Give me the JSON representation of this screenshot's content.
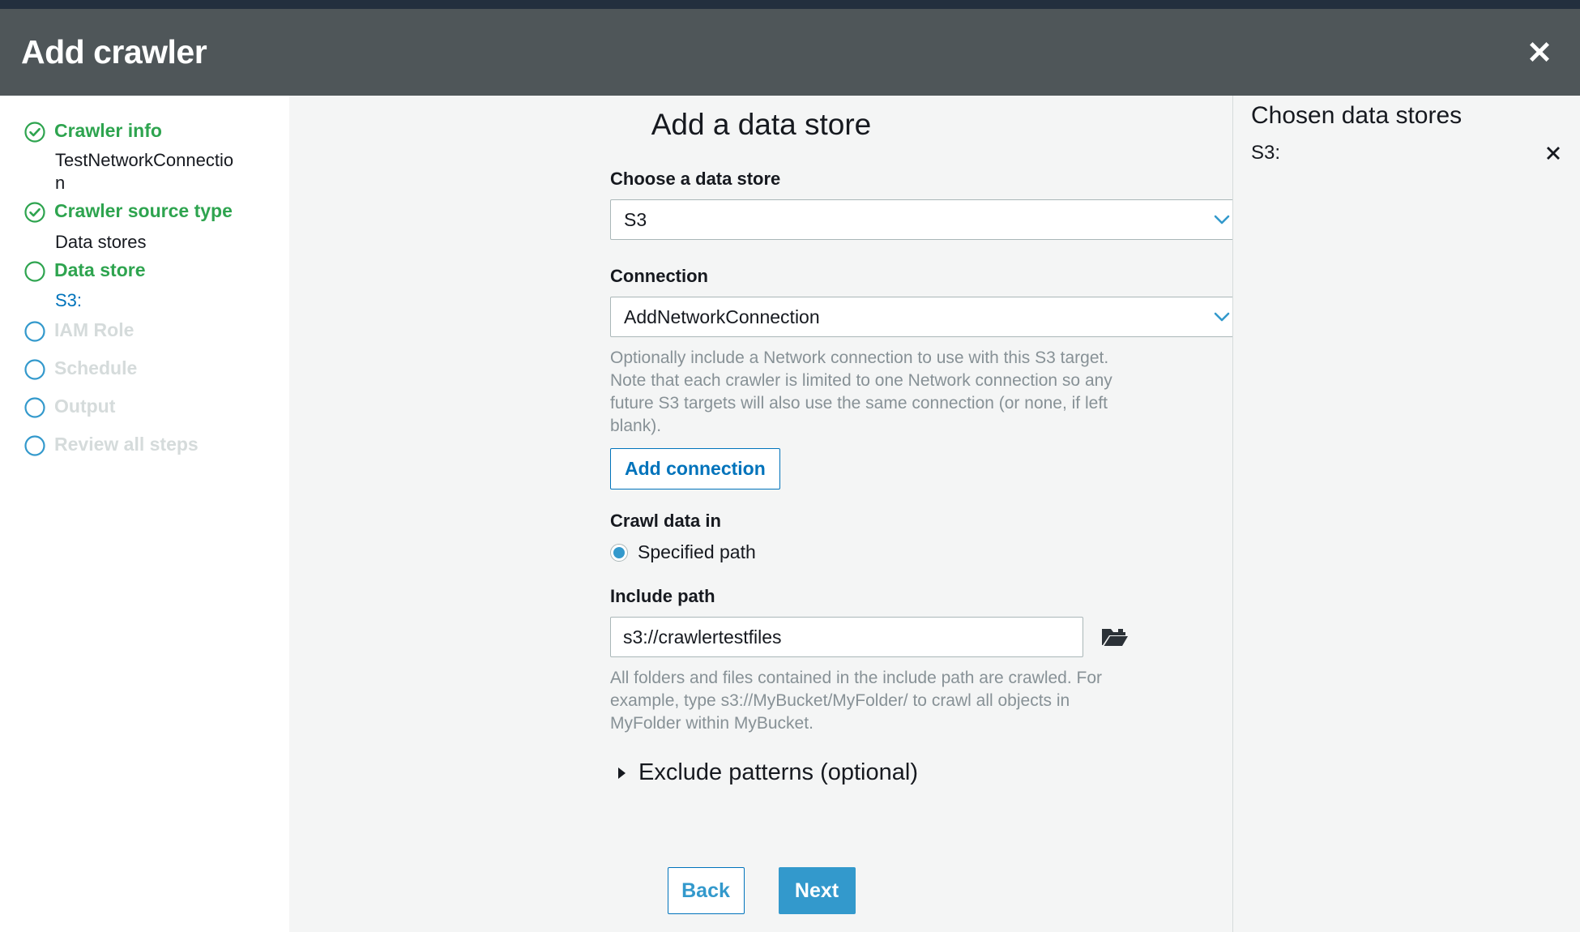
{
  "header": {
    "title": "Add crawler",
    "close_icon": "close-icon"
  },
  "sidebar": {
    "steps": [
      {
        "label": "Crawler info",
        "state": "done",
        "icon": "check-circle-icon"
      },
      {
        "label": "Crawler source type",
        "state": "done",
        "icon": "check-circle-icon"
      },
      {
        "label": "Data store",
        "state": "current",
        "icon": "circle-icon"
      },
      {
        "label": "IAM Role",
        "state": "future",
        "icon": "circle-icon"
      },
      {
        "label": "Schedule",
        "state": "future",
        "icon": "circle-icon"
      },
      {
        "label": "Output",
        "state": "future",
        "icon": "circle-icon"
      },
      {
        "label": "Review all steps",
        "state": "future",
        "icon": "circle-icon"
      }
    ],
    "sub_items": [
      {
        "label": "TestNetworkConnection",
        "style": "plain"
      },
      {
        "label": "Data stores",
        "style": "plain"
      },
      {
        "label": "S3:",
        "style": "link"
      }
    ]
  },
  "main": {
    "title": "Add a data store",
    "data_store": {
      "label": "Choose a data store",
      "value": "S3",
      "chevron_icon": "chevron-down-icon"
    },
    "connection": {
      "label": "Connection",
      "value": "AddNetworkConnection",
      "chevron_icon": "chevron-down-icon",
      "help": "Optionally include a Network connection to use with this S3 target. Note that each crawler is limited to one Network connection so any future S3 targets will also use the same connection (or none, if left blank).",
      "add_button": "Add connection"
    },
    "crawl_data_in": {
      "label": "Crawl data in",
      "options": [
        {
          "label": "Specified path",
          "selected": true
        }
      ]
    },
    "include_path": {
      "label": "Include path",
      "value": "s3://crawlertestfiles",
      "placeholder": "",
      "browse_icon": "folder-open-icon",
      "help": "All folders and files contained in the include path are crawled. For example, type s3://MyBucket/MyFolder/ to crawl all objects in MyFolder within MyBucket."
    },
    "exclude_patterns": {
      "label": "Exclude patterns (optional)",
      "expanded": false,
      "icon": "triangle-right-icon"
    },
    "actions": {
      "back": "Back",
      "next": "Next"
    }
  },
  "right_panel": {
    "title": "Chosen data stores",
    "items": [
      {
        "label": "S3:",
        "remove_icon": "close-icon"
      }
    ]
  },
  "colors": {
    "navy": "#232f3e",
    "header_gray": "#4f5659",
    "page_bg": "#f4f5f5",
    "accent_blue": "#3399cc",
    "link_blue": "#0073bb",
    "success_green": "#2ea44f",
    "muted_gray": "#879196",
    "disabled_gray": "#d5dbdb"
  }
}
